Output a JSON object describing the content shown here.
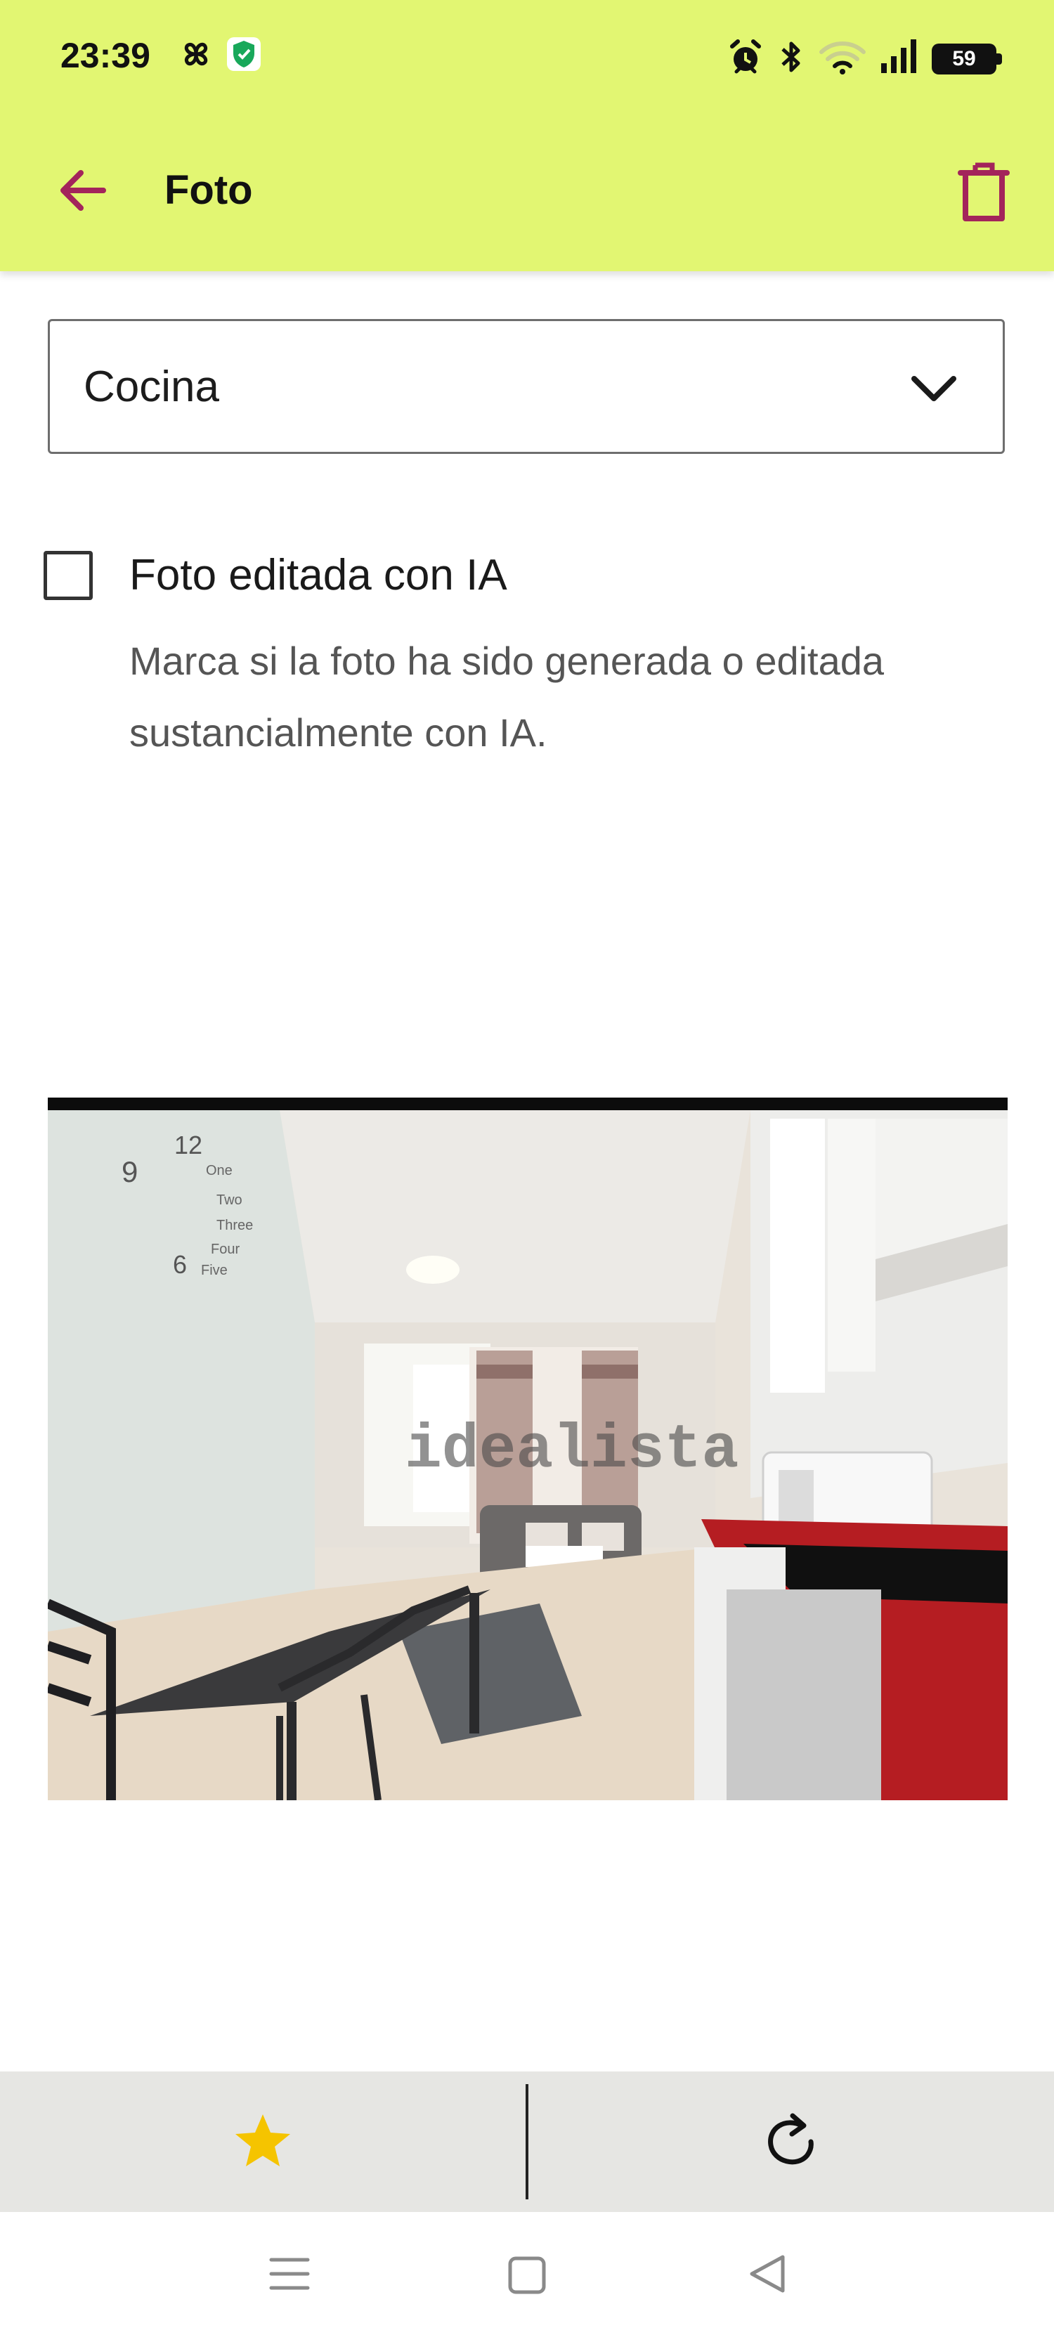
{
  "status_bar": {
    "time": "23:39",
    "left_icons": [
      "pinwheel-icon",
      "shield-check-icon"
    ],
    "right_icons": [
      "alarm-icon",
      "bluetooth-icon",
      "wifi-icon",
      "signal-icon"
    ],
    "battery_level": "59"
  },
  "app_bar": {
    "title": "Foto",
    "back_icon": "arrow-left-icon",
    "delete_icon": "trash-icon",
    "accent_color": "#a3245b",
    "background_color": "#e2f672"
  },
  "room_select": {
    "value": "Cocina"
  },
  "ai_checkbox": {
    "label": "Foto editada con IA",
    "help": "Marca si la foto ha sido generada o editada sustancialmente con IA.",
    "checked": false
  },
  "photo": {
    "watermark": "idealista",
    "wall_clock_numbers": [
      "9",
      "12",
      "6"
    ],
    "wall_clock_words": [
      "One",
      "Two",
      "Three",
      "Four",
      "Five"
    ]
  },
  "actions": {
    "favorite_icon": "star-icon",
    "rotate_icon": "rotate-icon",
    "star_color": "#f5c400"
  },
  "nav_bar": {
    "icons": [
      "menu-icon",
      "home-icon",
      "back-triangle-icon"
    ]
  }
}
